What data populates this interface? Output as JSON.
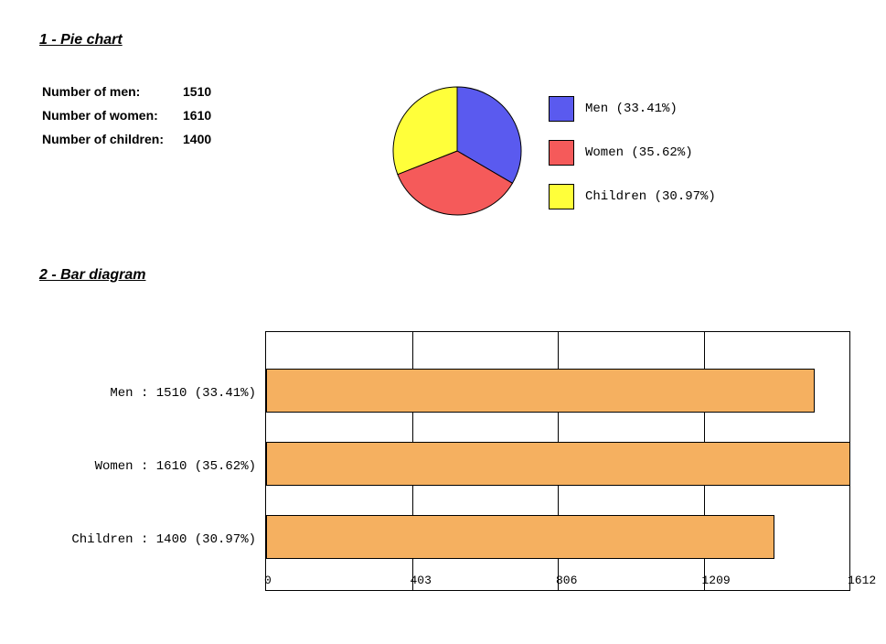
{
  "headings": {
    "pie": "1 - Pie chart",
    "bar": "2 - Bar diagram"
  },
  "summary": {
    "rows": [
      {
        "label": "Number of men:",
        "value": "1510"
      },
      {
        "label": "Number of women:",
        "value": "1610"
      },
      {
        "label": "Number of children:",
        "value": "1400"
      }
    ]
  },
  "pie": {
    "colors": {
      "men": "#5a5aef",
      "women": "#f55a5a",
      "children": "#ffff3a"
    },
    "legend": [
      {
        "label": "Men (33.41%)",
        "color": "#5a5aef"
      },
      {
        "label": "Women (35.62%)",
        "color": "#f55a5a"
      },
      {
        "label": "Children (30.97%)",
        "color": "#ffff3a"
      }
    ]
  },
  "bar": {
    "xmax": 1612,
    "ticks": [
      0,
      403,
      806,
      1209,
      1612
    ],
    "rows": [
      {
        "label": "Men : 1510 (33.41%)",
        "value": 1510
      },
      {
        "label": "Women : 1610 (35.62%)",
        "value": 1610
      },
      {
        "label": "Children : 1400 (30.97%)",
        "value": 1400
      }
    ],
    "bar_color": "#f5b060"
  },
  "chart_data": [
    {
      "type": "pie",
      "title": "1 - Pie chart",
      "categories": [
        "Men",
        "Women",
        "Children"
      ],
      "values": [
        1510,
        1610,
        1400
      ],
      "percentages": [
        33.41,
        35.62,
        30.97
      ]
    },
    {
      "type": "bar",
      "orientation": "horizontal",
      "title": "2 - Bar diagram",
      "categories": [
        "Men",
        "Women",
        "Children"
      ],
      "values": [
        1510,
        1610,
        1400
      ],
      "percentages": [
        33.41,
        35.62,
        30.97
      ],
      "xlim": [
        0,
        1612
      ],
      "xticks": [
        0,
        403,
        806,
        1209,
        1612
      ]
    }
  ]
}
